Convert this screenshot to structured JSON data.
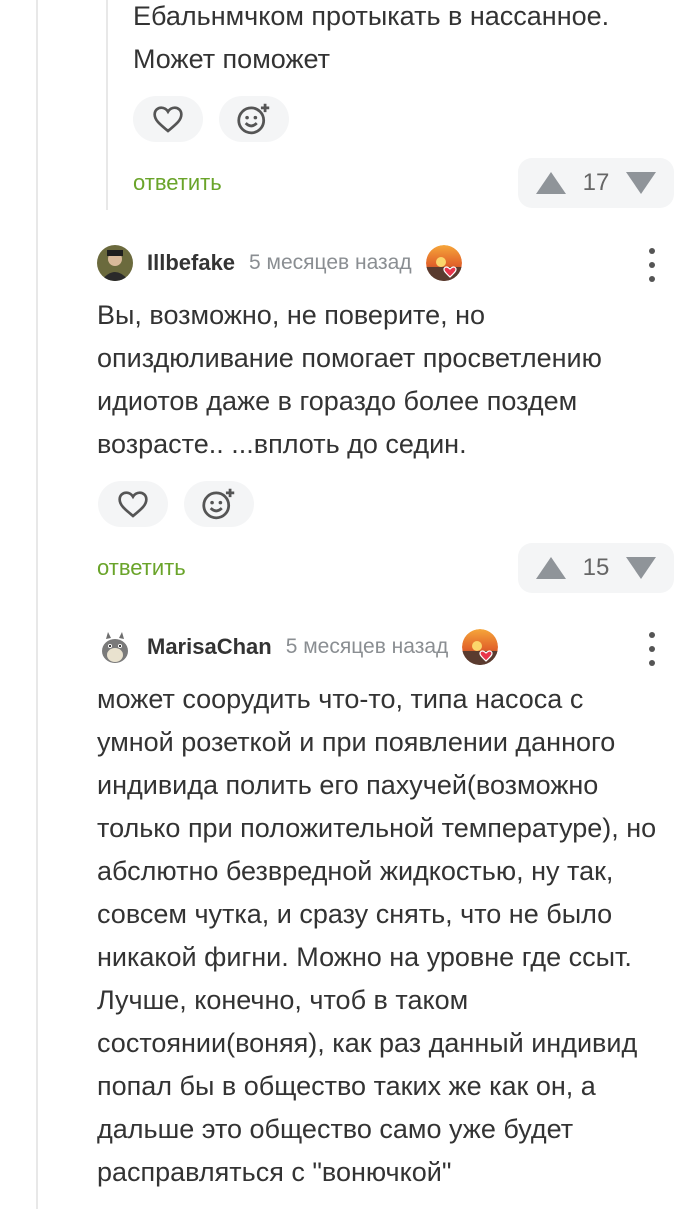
{
  "comment1": {
    "text_line1": "Ебальнмчком протыкать в нассанное.",
    "text_line2": "Может поможет",
    "reply_label": "ответить",
    "votes": "17"
  },
  "comment2": {
    "username": "Illbefake",
    "time": "5 месяцев назад",
    "text": "Вы, возможно, не поверите, но опиздюливание помогает просветлению идиотов даже в гораздо более поздем возрасте.. ...вплоть до седин.",
    "reply_label": "ответить",
    "votes": "15"
  },
  "comment3": {
    "username": "MarisaChan",
    "time": "5 месяцев назад",
    "text": "может соорудить что-то, типа насоса с умной розеткой и при появлении данного индивида полить его пахучей(возможно только при положительной температуре), но абслютно безвредной жидкостью, ну так, совсем чутка, и сразу снять, что не было никакой фигни. Можно на уровне где ссыт. Лучше, конечно, чтоб в таком состоянии(воняя), как раз данный индивид попал бы в общество таких же как он, а дальше это общество само уже будет расправляться с \"вонючкой\""
  },
  "colors": {
    "accent": "#6aa42a",
    "button_bg": "#f4f5f6",
    "heart": "#e8354a"
  }
}
